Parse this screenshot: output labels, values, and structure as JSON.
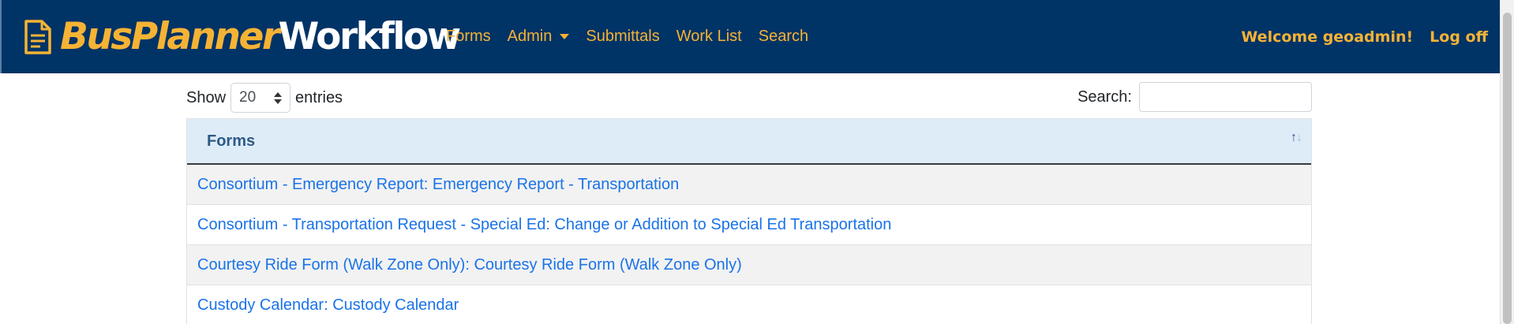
{
  "navbar": {
    "brand": {
      "part1": "BusPlanner",
      "part2": "Workflow",
      "icon": "document-icon"
    },
    "links": [
      {
        "label": "Forms",
        "name": "nav-forms"
      },
      {
        "label": "Admin",
        "name": "nav-admin",
        "dropdown": true
      },
      {
        "label": "Submittals",
        "name": "nav-submittals"
      },
      {
        "label": "Work List",
        "name": "nav-work-list"
      },
      {
        "label": "Search",
        "name": "nav-search"
      }
    ],
    "welcome": "Welcome geoadmin!",
    "logoff": "Log off",
    "colors": {
      "background": "#003366",
      "accent": "#f5b335",
      "text_light": "#ffffff"
    }
  },
  "controls": {
    "show_label": "Show",
    "entries_value": "20",
    "entries_label": "entries",
    "search_label": "Search:",
    "search_value": ""
  },
  "table": {
    "header": "Forms",
    "sort_icon": "sort-arrows-icon",
    "rows": [
      "Consortium - Emergency Report: Emergency Report - Transportation",
      "Consortium - Transportation Request - Special Ed: Change or Addition to Special Ed Transportation",
      "Courtesy Ride Form (Walk Zone Only): Courtesy Ride Form (Walk Zone Only)",
      "Custody Calendar: Custody Calendar"
    ],
    "colors": {
      "header_bg": "#deecf8",
      "header_text": "#2e5a86",
      "link": "#1a73e8"
    }
  }
}
